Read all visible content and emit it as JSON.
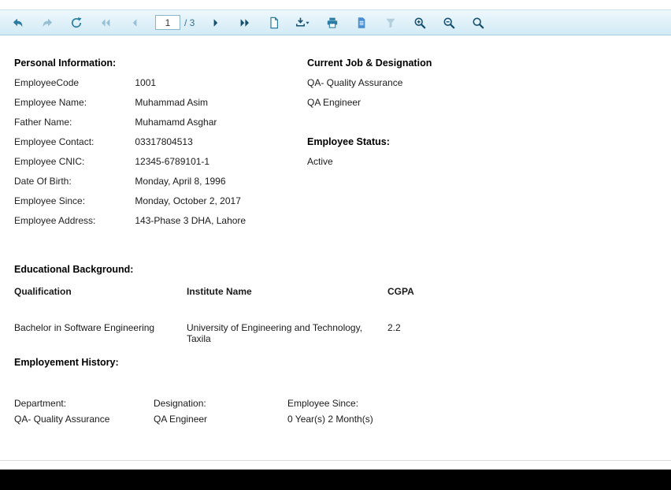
{
  "colors": {
    "toolbar_bg_top": "#eef8fd",
    "toolbar_bg_bottom": "#d2eaf5",
    "icon_enabled": "#2a7ca3",
    "icon_disabled": "#97c0d4",
    "icon_dark": "#15506f",
    "document_icon_blue": "#4a8fd2",
    "bottom_bar": "#000000"
  },
  "toolbar": {
    "page_input_value": "1",
    "page_total_label": "/ 3",
    "icons": [
      "back",
      "forward",
      "refresh",
      "first-page",
      "previous-page",
      "next-page",
      "last-page",
      "page-setup",
      "export",
      "print",
      "document",
      "filter",
      "zoom-in",
      "zoom-out",
      "search"
    ]
  },
  "personal_info": {
    "title": "Personal Information:",
    "rows": [
      {
        "label": "EmployeeCode",
        "value": "1001"
      },
      {
        "label": "Employee Name:",
        "value": "Muhammad  Asim"
      },
      {
        "label": "Father Name:",
        "value": "Muhamamd Asghar"
      },
      {
        "label": "Employee Contact:",
        "value": "03317804513"
      },
      {
        "label": "Employee CNIC:",
        "value": "12345-6789101-1"
      },
      {
        "label": "Date Of Birth:",
        "value": "Monday, April 8, 1996"
      },
      {
        "label": "Employee Since:",
        "value": "Monday, October 2, 2017"
      },
      {
        "label": "Employee Address:",
        "value": "143-Phase 3 DHA, Lahore"
      }
    ]
  },
  "current_job": {
    "title": "Current Job & Designation",
    "department": "QA- Quality Assurance",
    "designation": "QA Engineer"
  },
  "employee_status": {
    "title": "Employee Status:",
    "value": "Active"
  },
  "education": {
    "title": "Educational Background:",
    "headers": [
      "Qualification",
      "Institute Name",
      "CGPA"
    ],
    "rows": [
      {
        "qualification": "Bachelor in Software Engineering",
        "institute": "University of Engineering and Technology, Taxila",
        "cgpa": "2.2"
      }
    ]
  },
  "employment_history": {
    "title": "Employement History:",
    "headers": [
      "Department:",
      "Designation:",
      "Employee Since:"
    ],
    "rows": [
      {
        "department": "QA- Quality Assurance",
        "designation": "QA Engineer",
        "since": "0 Year(s) 2 Month(s)"
      }
    ]
  }
}
